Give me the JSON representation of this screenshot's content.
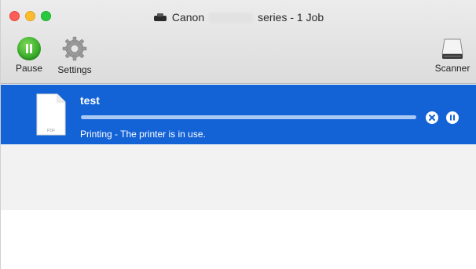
{
  "window": {
    "title_brand": "Canon",
    "title_suffix": "series - 1 Job"
  },
  "toolbar": {
    "pause_label": "Pause",
    "settings_label": "Settings",
    "scanner_label": "Scanner"
  },
  "jobs": [
    {
      "name": "test",
      "status": "Printing - The printer is in use.",
      "file_badge": "PDF",
      "progress_fraction": 1.0
    }
  ],
  "icons": {
    "title": "printer-icon",
    "pause": "pause-icon",
    "settings": "gear-icon",
    "scanner": "scanner-icon",
    "document": "pdf-document-icon",
    "cancel_job": "cancel-job-icon",
    "pause_job": "pause-job-icon"
  },
  "colors": {
    "selection": "#1463d6",
    "pause_green": "#2fa625",
    "close_red": "#fd5d56",
    "minimize_yellow": "#fdbb2d",
    "zoom_green": "#27c941"
  }
}
